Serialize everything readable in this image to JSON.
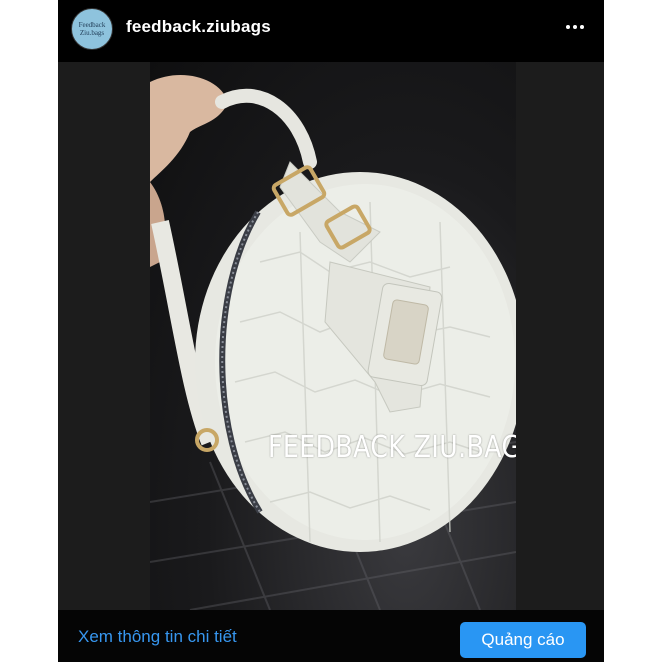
{
  "post": {
    "avatar": {
      "line1": "Feedback",
      "line2": "Ziu.bags"
    },
    "username": "feedback.ziubags",
    "more_icon": "more-horizontal-icon"
  },
  "media": {
    "overlay_text": "FEEDBACK ZIU.BAGS"
  },
  "footer": {
    "details_link": "Xem thông tin chi tiết",
    "ad_button": "Quảng cáo"
  },
  "colors": {
    "background": "#000000",
    "link": "#3797f0",
    "button": "#2996f3"
  }
}
